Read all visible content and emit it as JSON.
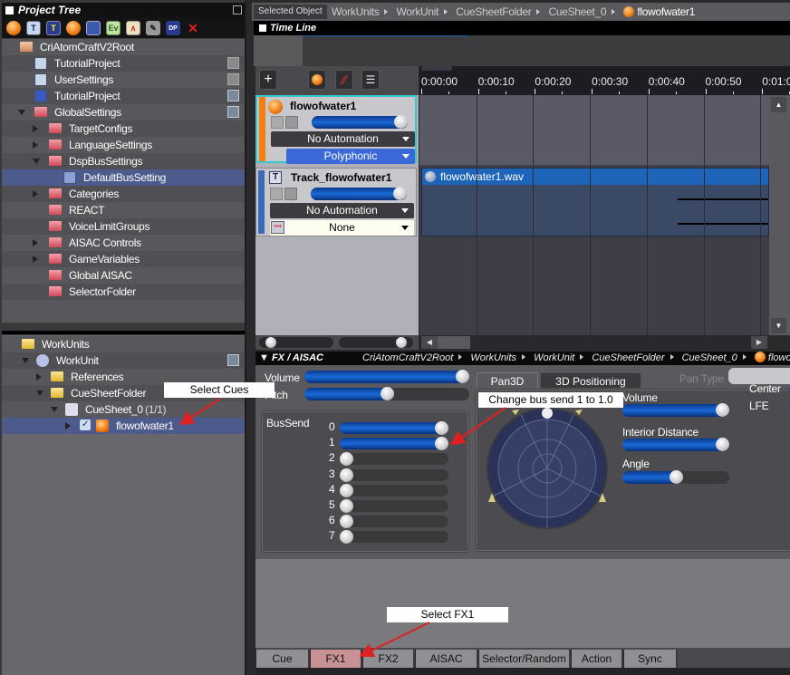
{
  "project_tree": {
    "title": "Project Tree",
    "toolbar_icons": [
      "cue-orb-icon",
      "track-icon",
      "track-action-icon",
      "orb-icon",
      "waveform-region-icon",
      "event-icon",
      "aisac-graph-icon",
      "tool-icon",
      "dsp-icon",
      "delete-icon"
    ],
    "items": [
      {
        "label": "CriAtomCraftV2Root",
        "depth": 0,
        "icon": "folder-open-icon",
        "expand": "none",
        "save": false
      },
      {
        "label": "TutorialProject",
        "depth": 1,
        "icon": "project-icon",
        "expand": "none",
        "save": "dim"
      },
      {
        "label": "UserSettings",
        "depth": 1,
        "icon": "user-settings-icon",
        "expand": "none",
        "save": "dim"
      },
      {
        "label": "TutorialProject",
        "depth": 1,
        "icon": "wave-icon",
        "expand": "none",
        "save": "on"
      },
      {
        "label": "GlobalSettings",
        "depth": 1,
        "icon": "folder-icon",
        "expand": "down",
        "save": "on"
      },
      {
        "label": "TargetConfigs",
        "depth": 2,
        "icon": "folder-icon",
        "expand": "right",
        "save": false
      },
      {
        "label": "LanguageSettings",
        "depth": 2,
        "icon": "folder-icon",
        "expand": "right",
        "save": false
      },
      {
        "label": "DspBusSettings",
        "depth": 2,
        "icon": "folder-icon",
        "expand": "down",
        "save": false
      },
      {
        "label": "DefaultBusSetting",
        "depth": 3,
        "icon": "bus-setting-icon",
        "expand": "none",
        "save": false,
        "selected": true
      },
      {
        "label": "Categories",
        "depth": 2,
        "icon": "folder-icon",
        "expand": "right",
        "save": false
      },
      {
        "label": "REACT",
        "depth": 2,
        "icon": "folder-icon",
        "expand": "none",
        "save": false
      },
      {
        "label": "VoiceLimitGroups",
        "depth": 2,
        "icon": "folder-icon",
        "expand": "none",
        "save": false
      },
      {
        "label": "AISAC Controls",
        "depth": 2,
        "icon": "folder-icon",
        "expand": "right",
        "save": false
      },
      {
        "label": "GameVariables",
        "depth": 2,
        "icon": "folder-icon",
        "expand": "right",
        "save": false
      },
      {
        "label": "Global AISAC",
        "depth": 2,
        "icon": "folder-icon",
        "expand": "none",
        "save": false
      },
      {
        "label": "SelectorFolder",
        "depth": 2,
        "icon": "folder-icon",
        "expand": "none",
        "save": false
      }
    ]
  },
  "work_tree": {
    "items": [
      {
        "label": "WorkUnits",
        "depth": 0
      },
      {
        "label": "WorkUnit",
        "depth": 1
      },
      {
        "label": "References",
        "depth": 2
      },
      {
        "label": "CueSheetFolder",
        "depth": 2
      },
      {
        "label": "CueSheet_0",
        "count": "(1/1)",
        "depth": 3
      },
      {
        "label": "flowofwater1",
        "depth": 4,
        "selected": true
      }
    ]
  },
  "selected_object": {
    "label": "Selected Object",
    "path": [
      "WorkUnits",
      "WorkUnit",
      "CueSheetFolder",
      "CueSheet_0",
      "flowofwater1"
    ]
  },
  "timeline": {
    "title": "Time Line",
    "ruler_ticks": [
      "0:00:00",
      "0:00:10",
      "0:00:20",
      "0:00:30",
      "0:00:40",
      "0:00:50",
      "0:01:0"
    ],
    "cue_track": {
      "name": "flowofwater1",
      "volume": 1.0,
      "automation": "No Automation",
      "mode": "Polyphonic"
    },
    "track": {
      "name": "Track_flowofwater1",
      "volume": 1.0,
      "automation": "No Automation",
      "option": "None"
    },
    "waveform_clip": "flowofwater1.wav",
    "zoom_sliders": [
      0.1,
      0.9
    ]
  },
  "fx_panel": {
    "title": "FX / AISAC",
    "path": [
      "CriAtomCraftV2Root",
      "WorkUnits",
      "WorkUnit",
      "CueSheetFolder",
      "CueSheet_0",
      "flowo"
    ],
    "volume_label": "Volume",
    "pitch_label": "Pitch",
    "volume": 1.0,
    "pitch": 0.5,
    "bussend_label": "BusSend",
    "bussends": [
      {
        "label": "0",
        "value": 1.0
      },
      {
        "label": "1",
        "value": 1.0
      },
      {
        "label": "2",
        "value": 0
      },
      {
        "label": "3",
        "value": 0
      },
      {
        "label": "4",
        "value": 0
      },
      {
        "label": "5",
        "value": 0
      },
      {
        "label": "6",
        "value": 0
      },
      {
        "label": "7",
        "value": 0
      }
    ],
    "pan_tabs": [
      "Pan3D",
      "3D Positioning"
    ],
    "pan_type_label": "Pan Type",
    "pan_volume_label": "Volume",
    "pan_volume": 1.0,
    "interior_distance_label": "Interior Distance",
    "interior_distance": 1.0,
    "angle_label": "Angle",
    "angle": 0.5,
    "center_label": "Center",
    "lfe_label": "LFE"
  },
  "annotations": {
    "select_cues": "Select Cues",
    "change_bus": "Change bus send 1 to 1.0",
    "select_fx1": "Select FX1"
  },
  "bottom_tabs": [
    {
      "label": "Cue",
      "active": false
    },
    {
      "label": "FX1",
      "active": true
    },
    {
      "label": "FX2",
      "active": false
    },
    {
      "label": "AISAC",
      "active": false
    },
    {
      "label": "Selector/Random",
      "active": false
    },
    {
      "label": "Action",
      "active": false
    },
    {
      "label": "Sync",
      "active": false
    }
  ],
  "colors": {
    "accent_blue": "#1a6ad8",
    "cue_orange": "#f08010",
    "selected_row": "#4c5a8c",
    "active_tab": "#c89294",
    "clip_blue": "#1e64b8",
    "annotation_arrow": "#e02020"
  }
}
